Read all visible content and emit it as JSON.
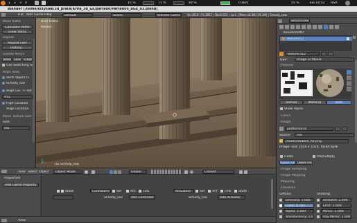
{
  "taskbar": {
    "left_items": [
      "1",
      "2",
      "3",
      "4"
    ],
    "percent1": "15 %",
    "percent2": "71 %",
    "percent3": "49 %",
    "speed": "0 kB/s",
    "up": "55 %",
    "date": "Tue 16:52",
    "country": "USA"
  },
  "title": {
    "text": "Blender [/home/krzysiek/3d_prace/Krifa_3d_GE/parteon/Partenon_BGE_03.blend]"
  },
  "info_header": {
    "menus": [
      "File",
      "Add",
      "Game",
      "Help"
    ],
    "layout": "Default",
    "scene": "Scene",
    "engine": "Blender Game",
    "stats": "Ve:3516 | Fa:2811 | Ob:0-312 | La:1 | Mem:34.5M (34.1M) | Schody_Low"
  },
  "toolshelf": {
    "header1": "Mesh Paths",
    "btn_calc_paths": "Calculate Paths",
    "btn_clear_paths": "Clear Paths",
    "header2": "Repeat",
    "btn_repeat_last": "Repeat Last",
    "btn_history": "History...",
    "header3": "Grease Pencil",
    "gp_draw": "Draw",
    "gp_line": "Line",
    "gp_erase": "Erase",
    "gp_sketch": "Use Sketching Se",
    "header4": "Align Tools",
    "align_opt1": "Verts object (s",
    "align_opt2": "Schody_low",
    "align_opt3": "Align Loc -> Rot",
    "axis": "XYZ",
    "align_opt4": "High Location",
    "align_opt5": "Align Location",
    "header5": "Move Texture Size",
    "size_label": "Size:",
    "size_value": "top"
  },
  "viewport": {
    "view_name": "User Ortho",
    "units": "Meters",
    "object_label": "(0) Schody_low"
  },
  "viewport_header": {
    "menus": [
      "View",
      "Select",
      "Object"
    ],
    "mode": "Object Mode",
    "orientation": "Global",
    "proportional": "Closest"
  },
  "properties": {
    "search_value": "Kolumna040",
    "material_name": "Kolumna040",
    "object_name": "Belkon012",
    "texture_name": "Texture.012",
    "type_label": "Type:",
    "type_value": "Image or Movie",
    "preview_label": "Preview",
    "preview_tabs": [
      "Texture",
      "Material",
      "Both"
    ],
    "show_alpha": "Show Alpha",
    "colors": "Colors",
    "image": "Image",
    "image_name": "platform010",
    "source_label": "Source:",
    "source_value": "File",
    "file_path": "//textures/belk_A0.png",
    "image_info": "Image: size 1024 x 1024, RGBA byte",
    "fields_label": "Fields",
    "premultiply": "Premultiply",
    "field_btns": [
      "Upper First",
      "Lower First"
    ],
    "image_sampling": "Image Sampling",
    "image_mapping": "Image Mapping",
    "mapping": "Mapping",
    "influence": "Influence",
    "diffuse_label": "Diffuse:",
    "shading_label": "Shading:",
    "diffuse_fields": [
      "Intensity: 1.000",
      "Color: 0.781",
      "Alpha: 1.000",
      "Translucency: 1.000"
    ],
    "shading_fields": [
      "Ambient: 1.000",
      "Emit: 1.000",
      "Mirror: 1.000",
      "Ray Mirror: 1.000"
    ]
  },
  "logic": {
    "header": "Properties",
    "add_property": "Add Game Property",
    "sensors": {
      "label": "Sensors",
      "sel": "Sel",
      "act": "Act",
      "link": "Link",
      "add": "Add Sensor",
      "object": "Schody_low"
    },
    "controllers": {
      "label": "Controllers",
      "sel": "Sel",
      "act": "Act",
      "link": "Link",
      "add": "Add Controller",
      "object": "Schody_low"
    },
    "actuators": {
      "label": "Actuators",
      "sel": "Sel",
      "act": "Act",
      "link": "Link",
      "state": "State",
      "add": "Add Actuator",
      "object": "Schody_low"
    },
    "footer_view": "View",
    "footer_select": "Select"
  },
  "colors": {
    "accent_blue": "#5680c2",
    "active_green": "#29c24a",
    "active_orange": "#e98a2e"
  }
}
